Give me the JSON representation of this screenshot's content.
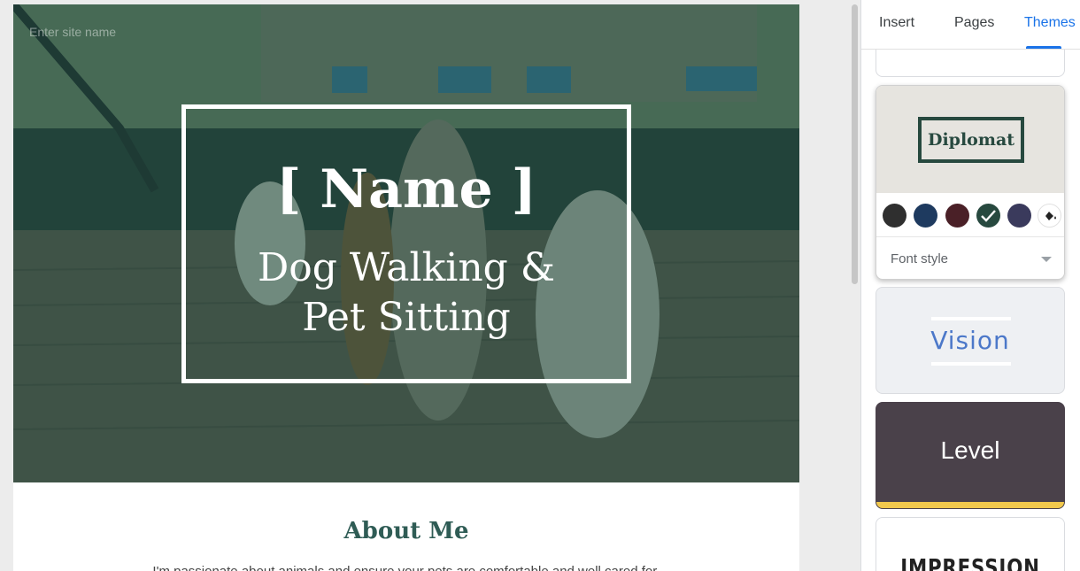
{
  "site": {
    "name_placeholder": "Enter site name",
    "hero": {
      "name": "[ Name ]",
      "tagline": "Dog Walking &\nPet Sitting"
    },
    "about": {
      "title": "About Me",
      "text": "I'm passionate about animals and ensure your pets are comfortable and well cared for."
    }
  },
  "panel": {
    "tabs": [
      {
        "label": "Insert",
        "active": false
      },
      {
        "label": "Pages",
        "active": false
      },
      {
        "label": "Themes",
        "active": true
      }
    ],
    "themes": [
      {
        "name": "Diplomat",
        "selected": true,
        "swatches": [
          "#2f2f2f",
          "#1e3a5f",
          "#4a2027",
          "#27493f",
          "#3a3a5c"
        ],
        "selected_swatch": "#27493f",
        "font_style_label": "Font style"
      },
      {
        "name": "Vision"
      },
      {
        "name": "Level",
        "accent": "#f2c94c"
      },
      {
        "name": "IMPRESSION"
      }
    ]
  }
}
